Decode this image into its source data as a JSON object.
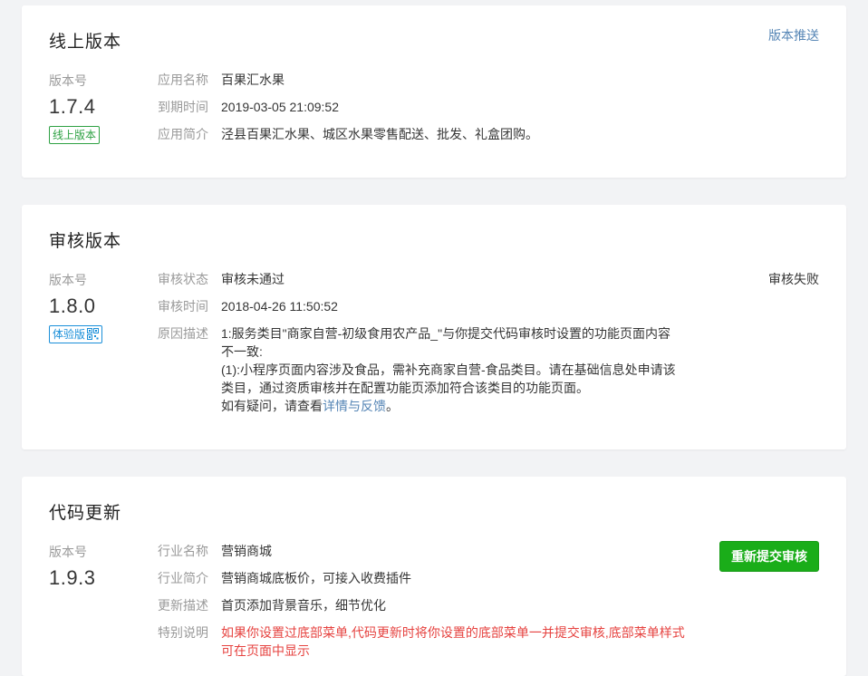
{
  "online": {
    "title": "线上版本",
    "push_link": "版本推送",
    "version_label": "版本号",
    "version": "1.7.4",
    "badge": "线上版本",
    "rows": [
      {
        "key": "应用名称",
        "value": "百果汇水果"
      },
      {
        "key": "到期时间",
        "value": "2019-03-05 21:09:52"
      },
      {
        "key": "应用简介",
        "value": "泾县百果汇水果、城区水果零售配送、批发、礼盒团购。"
      }
    ]
  },
  "review": {
    "title": "审核版本",
    "status_right": "审核失败",
    "version_label": "版本号",
    "version": "1.8.0",
    "badge": "体验版",
    "status_key": "审核状态",
    "status_value": "审核未通过",
    "time_key": "审核时间",
    "time_value": "2018-04-26 11:50:52",
    "reason_key": "原因描述",
    "reason_lines": [
      "1:服务类目\"商家自营-初级食用农产品_\"与你提交代码审核时设置的功能页面内容",
      "不一致:",
      "(1):小程序页面内容涉及食品，需补充商家自营-食品类目。请在基础信息处申请该",
      "类目，通过资质审核并在配置功能页添加符合该类目的功能页面。"
    ],
    "question_prefix": "如有疑问，请查看",
    "question_link": "详情与反馈",
    "question_suffix": "。"
  },
  "code": {
    "title": "代码更新",
    "version_label": "版本号",
    "version": "1.9.3",
    "resubmit_button": "重新提交审核",
    "rows": [
      {
        "key": "行业名称",
        "value": "营销商城"
      },
      {
        "key": "行业简介",
        "value": "营销商城底板价，可接入收费插件"
      },
      {
        "key": "更新描述",
        "value": "首页添加背景音乐，细节优化"
      }
    ],
    "note_key": "特别说明",
    "note_value": "如果你设置过底部菜单,代码更新时将你设置的底部菜单一并提交审核,底部菜单样式可在页面中显示"
  },
  "colors": {
    "green_badge": "#2ea143",
    "blue_badge": "#1a8fd9",
    "link": "#5585b5",
    "primary_button": "#1aad19",
    "warning": "#e64340"
  },
  "icons": {
    "qr": "qrcode-icon"
  }
}
